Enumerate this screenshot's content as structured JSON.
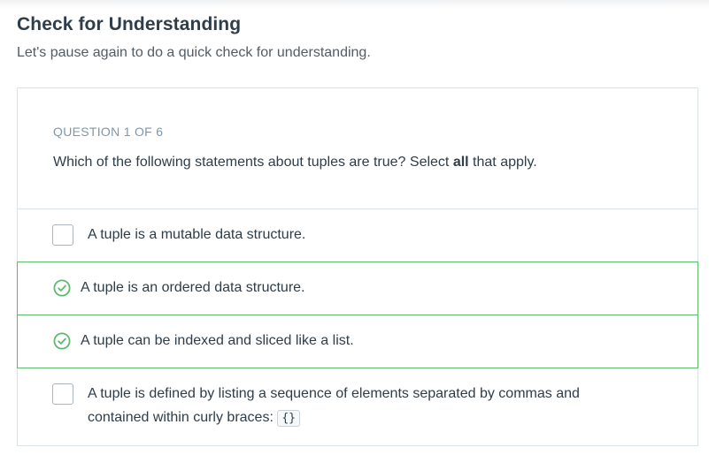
{
  "header": {
    "title": "Check for Understanding",
    "subtitle": "Let's pause again to do a quick check for understanding."
  },
  "quiz": {
    "counter": "QUESTION 1 OF 6",
    "prompt_before": "Which of the following statements about tuples are true? Select ",
    "prompt_bold": "all",
    "prompt_after": " that apply.",
    "options": [
      {
        "label": "A tuple is a mutable data structure.",
        "state": "unchecked"
      },
      {
        "label": "A tuple is an ordered data structure.",
        "state": "correct"
      },
      {
        "label": "A tuple can be indexed and sliced like a list.",
        "state": "correct"
      },
      {
        "label": "A tuple is defined by listing a sequence of elements separated by commas and contained within curly braces:",
        "code": "{}",
        "state": "unchecked"
      }
    ]
  },
  "colors": {
    "correct": "#5dba6f",
    "border": "#dbe2e8",
    "text": "#2e3d49",
    "muted": "#7d97ad"
  }
}
